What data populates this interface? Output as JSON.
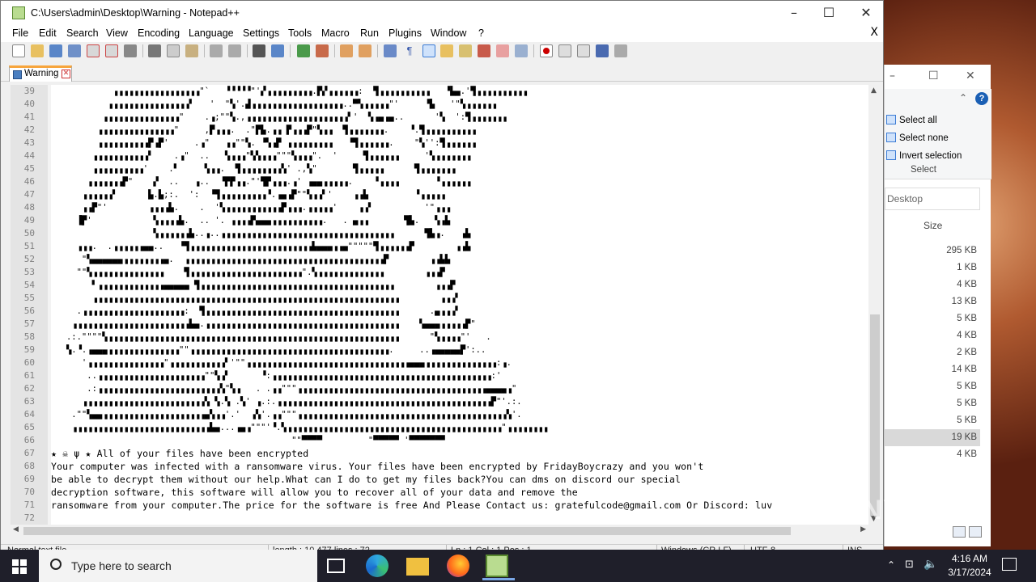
{
  "window": {
    "title": "C:\\Users\\admin\\Desktop\\Warning - Notepad++"
  },
  "menu": [
    "File",
    "Edit",
    "Search",
    "View",
    "Encoding",
    "Language",
    "Settings",
    "Tools",
    "Macro",
    "Run",
    "Plugins",
    "Window",
    "?"
  ],
  "menu_close": "X",
  "tab": {
    "label": "Warning"
  },
  "editor": {
    "lines": [
      {
        "n": "39",
        "text": "            ▗▗▗▗▗▗▗▗▗▗▗▗▗▗▗▗▗\"`   ▝▝▝▝▝\"'▞▗▗▗▗▗▗▗▗▗.▛▞▗▗▗▗▗▗:  ▜▗▗▗▗▗▗▗▗▗▗   ▝▙▄.'▜▗▗▗▗▗▗▗▗▗▗"
      },
      {
        "n": "40",
        "text": "           ▗▗▗▗▗▗▗▗▗▗▗▗▗▗▗▗▘   '  \"▚'.▟▗▗▗▗▗▗▗▗▗▗▗▗▗▗▗▗▗▗..▀▚▗▗▗▗▗\"'     ▝▙   '\"▚▗▗▗▗▗▗"
      },
      {
        "n": "41",
        "text": "          ▗▗▗▗▗▗▗▗▗▗▗▗▗▗▗\"    .▗;\"\"▚.,▗▗▗▗▗▗▗▗▗▗▗▗▗▗▗▗▗▗▗▗▘'  ▚▗▄▗▄..      '▚  ':▜▗▗▗▗▗▗▗"
      },
      {
        "n": "42",
        "text": "         ▗▗▗▗▗▗▗▗▗▗▗▗▗▗▗\"     ,▛▗▗▗.  .\"▛▙.▗▗ ▛▗▗▗▛\"▚▗▗  ▜▗▗▗▗▗▗▗.    ▝.▜▗▗▗▗▗▗▗▗▗▗"
      },
      {
        "n": "43",
        "text": "         ▗▗▗▗▗▗▗▗▗▗▛▗▛'     .▗\"   ▗▗\"\"▚. ▝▚▗▛ ▗▗▗▗▗▗▗▗▗   ▝▜▗▗▗▗▗▗.    \"▚'':▜▗▗▗▗▗▗"
      },
      {
        "n": "44",
        "text": "        ▗▗▗▗▗▗▗▗▗▗▗▘    .▗\"  ..   ▚▗▗▗\"▚▚▗▗▗\"\"\"▚▗▗▗\".  '     ▜▗▗▗▗▗▗     '▚▗▗▗▗▗▗▗"
      },
      {
        "n": "45",
        "text": "        ▗▗▗▗▗▗▗▗▗▗'    .▘     ▚▗▗.  ▜▗▗▗▗▗▗▗▗▚' .,▚\"       ▜▗▗▗▗▗      ▜▗▗▗▗▗▗▗"
      },
      {
        "n": "46",
        "text": "       ▗▗▗▗▗▗▗▛\"    ▞  ..   ▗..  ▝▛▛▗▗.\"'▜▛▗▗▗.▗' ▗▄▄▗▗▗▗▗.    ▝▗▗▗▗       ▝▗▗▗▗▗▗"
      },
      {
        "n": "47",
        "text": "      ▗▗▗▗▗▗▘      ▙.▙;:.  ':  ▝▜▗▗▗▗▗▗▗▗▗▝.▗▄▗▛\"\"▚▗▗▘'    ▗▗▙         ▝▗▗▗▗▗"
      },
      {
        "n": "48",
        "text": "      ▗▗▛\"'        ▗▗▗▗▙.    .  '▚▗▗▗▗▗▗▗▗▗▗▗▛▗▗▗.▗▗▗▗▗'    ▗▗▘          '\"▗▗▗"
      },
      {
        "n": "49",
        "text": "     ▐▛'            ▚▗▗▗▗▙.  .. '. ▗▗▗▗▛▄▄▄▗▗▗▗▗▗▗▗▗▗.   . ▄▗▗       ▜▙.   ▚▗▙"
      },
      {
        "n": "50",
        "text": "                    ▚▗▗▗▗▗▗▙..▗..▗▗▗▗▗▗▗▗▗▗▗▗▗▗▗▗▗▗▗▗▗▗▗▗▗▗▗▗▗▗▗▗▗▗      ▜▙▗.   ▗▙"
      },
      {
        "n": "51",
        "text": "     ▗▗▗.  .▗▗▗▗▗▗▄▄..   ▝▜▗▗▗▗▗▗▗▗▗▗▗▗▗▗▗▗▗▗▗▗▗▗▗▗▙▄▄▄▗▗▄\"\"\"\"\"▜▗▗▗▗▗▗▛        ▗▗▙"
      },
      {
        "n": "52",
        "text": "      \"▚▄▄▄▄▄▄▗▗▗▗▗▗▗▗▄.  ▗▗▗▗▗▗▗▗▗▗▗▗▗▗▗▗▗▗▗▗▗▗▗▗▗▗▗▗▗▗▗▗▗▗▗▗▗▗▗▛        ▗▗▙▙"
      },
      {
        "n": "53",
        "text": "     \"\"▚▗▗▗▗▗▗▗▗▗▗▗▗▗▗    ▜▗▗▗▗▗▗▗▗▗▗▗▗▗▗▗▗▗▗▗▗▗▗\".▚▗▗▗▗▗▗▗▗▗▗▗▗▗        ▗▗▗▛"
      },
      {
        "n": "54",
        "text": "        ▘▗▗▗▗▗▗▗▗▗▗▗▗▗▄▄▄▄▄ ▜▗▗▗▗▗▗▗▗▗▗▗▗▗▗▗▗▗▗▗▗▗▗▗▗▗▗▗▗▗▗▗▗▗▗▗▗▗▗        ▗▗▗▛"
      },
      {
        "n": "55",
        "text": "        ▗▗▗▗▗▗▗▗▗▗▗▗▗▗▗▗▗▗▗▗▗▗▗▗▗▗▗▗▗▗▗▗▗▗▗▗▗▗▗▗▗▗▗▗▗▗▗▗▗▗▗▗▗▗▗▗▗▗▗▗        ▗▗▗▘"
      },
      {
        "n": "56",
        "text": "     .▗▗▗▗▗▗▗▗▗▗▗▗▗▗▗▗▗▗▗▗:  ▜▗▗▗▗▗▗▗▗▗▗▗▗▗▗▗▗▗▗▗▗▗▗▗▗▗▗▗▗▗▗▗▗▗▗▗▗▗▗      .▄▗▗▗▘"
      },
      {
        "n": "57",
        "text": "    ▗▗▗▗▗▗▗▗▗▗▗▗▗▗▗▗▗▗▗▗▗▗▗▙▄.▗▗▗▗▗▗▗▗▗▗▗▗▗▗▗▗▗▗▗▗▗▗▗▗▗▗▗▗▗▗▗▗▗▗▗▗▗▗    ▚▄▄▄▗▗▗▗▗▛\""
      },
      {
        "n": "58",
        "text": "   .:.\"\"\"\"▚▗▗▗▗▗▗▗▗▗▗▗▗▗▗▗▗▗▗▗▗▗▗▗▗▗▗▗▗▗▗▗▗▗▗▗▗▗▗▗▗▗▗▗▗▗▗▗▗▗▗▗▗▗▗▗▗▗      \"▚▗▗▗▗\"'   ."
      },
      {
        "n": "59",
        "text": "   ▚.▝.▗▄▄▄▗▗▗▗▗▗▗▗▗▗▗▗▗▗\"\"▗▗▗▗▗▗▗▗▗▗▗▗▗▗▗▗▗▗▗▗▗▗▗▗▗▗▗▗▗▗▗▗▗▗▗▗▗▗▗.     ..▗▄▄▄▄▄▛':.."
      },
      {
        "n": "60",
        "text": "      '▗▗▗▗▗▗▗▗▗▗▗▗▗▗▗\"▗▗▗▗▗▗▗▗▗▗▗▘'\"\"▗▗▗▗▗▗▗▗▗▗▗▗▗▗▗▗▗▗▗▗▗▗▗▗▗▗▗▗▗▗▗▗▄▄▄▗▗▗▗▗▗▗▗▗▗▗▗▗▗:▗."
      },
      {
        "n": "61",
        "text": "       ..▗▗▗▗▗▗▗▗▗▗▗▗▗▗▗▗▗▗▗▗▗\"\"▚▗▘      ▝:▗▗▗▗▗▗▗▗▗▗▗▗▗▗▗▗▗▗▗▗▗▗▗▗▗▗▗▗▗▗▗▗▗▗▗▗▗▗▗▗▗▗▗:'"
      },
      {
        "n": "62",
        "text": "       .:▗▗▗▗▗▗▗▗▗▗▗▗▗▗▗▗▗▗▗▗▗▗▗▗▚\"▚▗   . .▗▗\"\"\"▗▗▗▗▗▗▗▗▗▗▗▗▗▗▗▗▗▗▗▗▗▗▗▗▗▗▗▗▗▗▗▗▗▗▗▗▗▄▄▄▄▗\""
      },
      {
        "n": "63",
        "text": "      ▗▗▗▗▗▗▗▗▗▗▗▗▗▗▗▗▗▗▗▗▗▗▗▗▚ ▚.▚ .▚' ▗.:.▗▗▗▗▗▗▗▗▗▗▗▗▗▗▗▗▗▗▗▗▗▗▗▗▗▗▗▗▗▗▗▗▗▗▗▗▗▗▗▗▗▗▛\"'.:."
      },
      {
        "n": "64",
        "text": "    .\"\"▚▄▄▗▗▗▗▗▗▗▗▗▗▗▗▗▗▗▗▗▗▗▗▄▚▗▗'.'  ▗▚'.▗▗\"\"\"▗▗▗▗▗▗▗▗▗▗▗▗▗▗▗▗▗▗▗▗▗▗▗▗▗▗▗▗▗▗▗▗▗▗▗▗▗▗▗▗▗▚'."
      },
      {
        "n": "65",
        "text": "    ▗▗▗▗▗▗▗▗▗▗▗▗▗▗▗▗▗▗▗▗▗▗▗▗▗▗▗▙▄...▗▄▗\"\"\"'▝.▚▗▗▗▗▗▗▗▗▗▗▗▗▗▗▗▗▗▗▗▗▗▗▗▗▗▗▗▗▗▗▗▗▗▗▗▗▗▗▗▗▗▗\"▗▗▗▗▗▗▗▗"
      },
      {
        "n": "66",
        "text": "                                               \"\"▀▀▀▀         \"▀▀▀▀▀ '▀▀▀▀▀▀▀"
      },
      {
        "n": "67",
        "text": "★ ☠ ψ ★ All of your files have been encrypted"
      },
      {
        "n": "68",
        "text": "Your computer was infected with a ransomware virus. Your files have been encrypted by FridayBoycrazy and you won't"
      },
      {
        "n": "69",
        "text": "be able to decrypt them without our help.What can I do to get my files back?You can dms on discord our special"
      },
      {
        "n": "70",
        "text": "decryption software, this software will allow you to recover all of your data and remove the"
      },
      {
        "n": "71",
        "text": "ransomware from your computer.The price for the software is free And Please Contact us: gratefulcode@gmail.com Or Discord: luv"
      },
      {
        "n": "72",
        "text": ""
      }
    ]
  },
  "status": {
    "type": "Normal text file",
    "length": "length : 10,477    lines : 72",
    "position": "Ln : 1    Col : 1    Pos : 1",
    "eol": "Windows (CR LF)",
    "encoding": "UTF-8",
    "mode": "INS"
  },
  "explorer": {
    "select_all": "Select all",
    "select_none": "Select none",
    "invert_selection": "Invert selection",
    "group_label": "Select",
    "address": "Desktop",
    "size_header": "Size",
    "sizes": [
      "295 KB",
      "1 KB",
      "4 KB",
      "13 KB",
      "5 KB",
      "4 KB",
      "2 KB",
      "14 KB",
      "5 KB",
      "5 KB",
      "5 KB",
      "19 KB",
      "4 KB"
    ],
    "selected_index": 11
  },
  "watermark": "ANY.RUN",
  "taskbar": {
    "search_placeholder": "Type here to search",
    "time": "4:16 AM",
    "date": "3/17/2024"
  },
  "colors": {
    "tab_accent": "#f7a53c",
    "taskbar": "#1f1f2a",
    "gutter": "#e4e4e4"
  }
}
